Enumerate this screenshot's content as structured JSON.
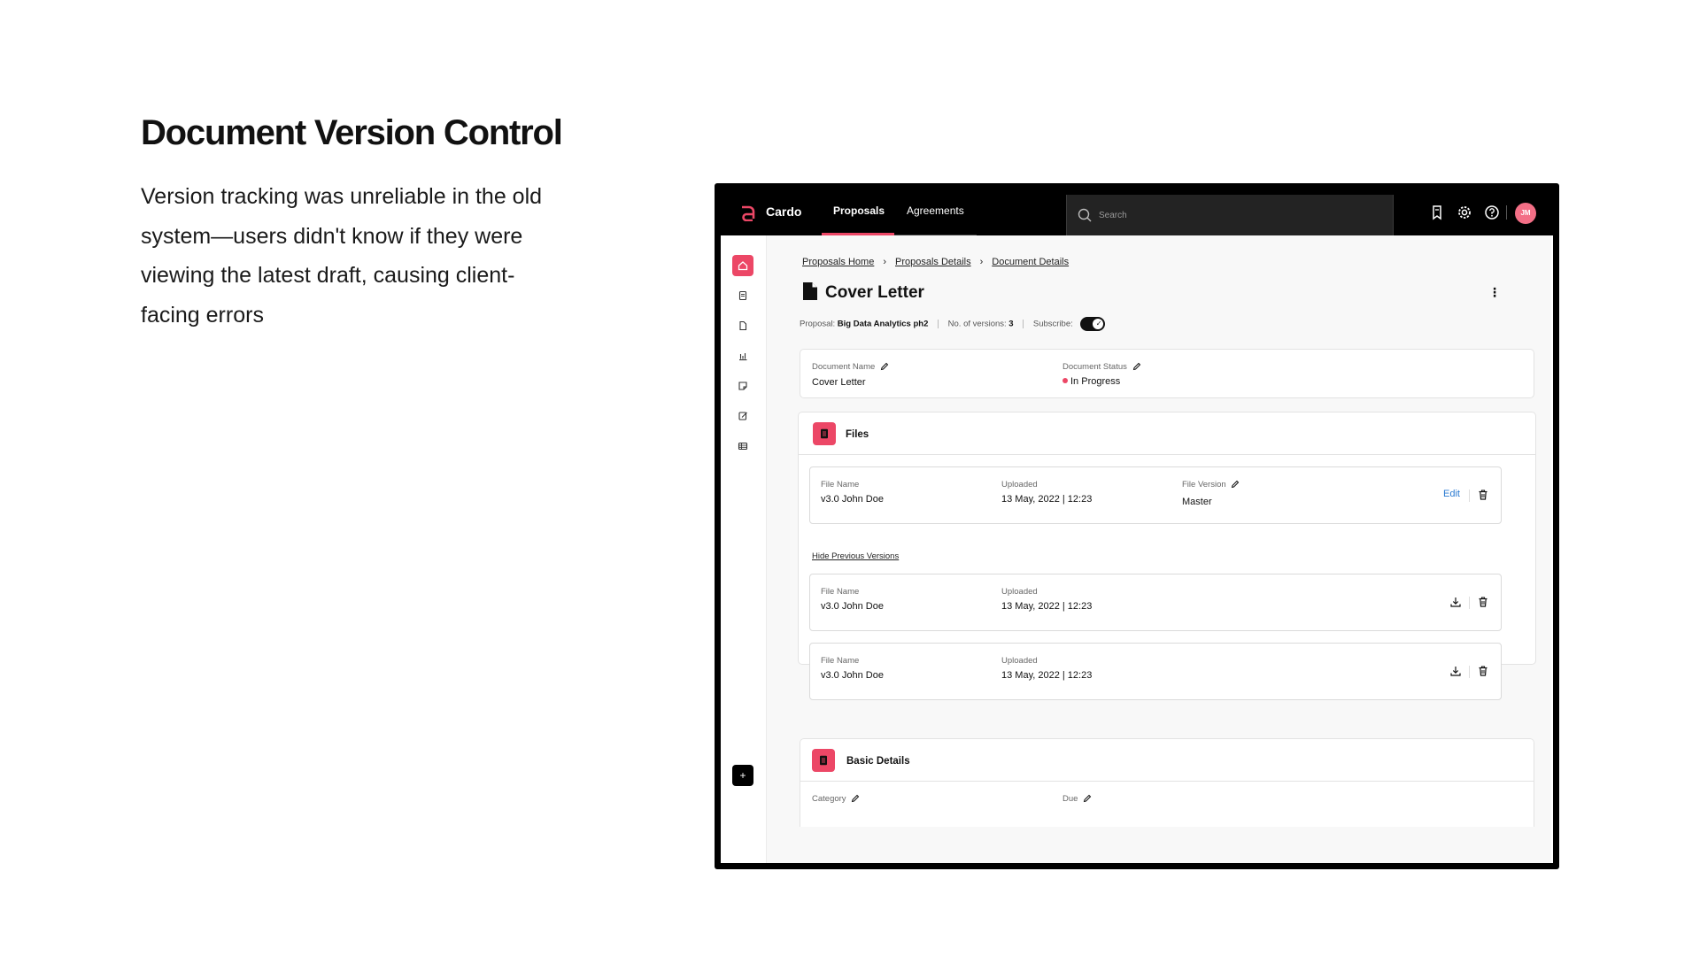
{
  "slide": {
    "title": "Document Version Control",
    "description": "Version tracking was unreliable in the old system—users didn't know if they were viewing the latest draft, causing client-facing errors"
  },
  "app": {
    "brand": "Cardo",
    "accent_color": "#ec4766",
    "nav": {
      "tabs": [
        {
          "label": "Proposals",
          "active": true
        },
        {
          "label": "Agreements",
          "active": false
        }
      ]
    },
    "search": {
      "placeholder": "Search",
      "icon": "search-icon"
    },
    "top_icons": [
      "bookmark-icon",
      "gear-icon",
      "help-icon"
    ],
    "avatar_initials": "JM",
    "sidebar": {
      "items": [
        "home-icon",
        "document-list-icon",
        "file-icon",
        "bar-chart-icon",
        "note-icon",
        "edit-note-icon",
        "table-icon"
      ],
      "add_label": "+"
    },
    "breadcrumb": [
      "Proposals Home",
      "Proposals Details",
      "Document Details"
    ],
    "page_title": "Cover Letter",
    "meta": {
      "proposal_label": "Proposal:",
      "proposal_value": "Big Data Analytics ph2",
      "versions_label": "No. of versions:",
      "versions_value": "3",
      "subscribe_label": "Subscribe:",
      "subscribed": true
    },
    "document_card": {
      "name_label": "Document Name",
      "name_value": "Cover Letter",
      "status_label": "Document Status",
      "status_value": "In Progress"
    },
    "files": {
      "title": "Files",
      "current": {
        "file_name_label": "File Name",
        "file_name": "v3.0 John Doe",
        "uploaded_label": "Uploaded",
        "uploaded": "13 May, 2022 | 12:23",
        "version_label": "File Version",
        "version": "Master",
        "edit_label": "Edit"
      },
      "hide_previous_label": "Hide Previous Versions",
      "previous": [
        {
          "file_name_label": "File Name",
          "file_name": "v3.0 John Doe",
          "uploaded_label": "Uploaded",
          "uploaded": "13 May, 2022 | 12:23"
        },
        {
          "file_name_label": "File Name",
          "file_name": "v3.0 John Doe",
          "uploaded_label": "Uploaded",
          "uploaded": "13 May, 2022 | 12:23"
        }
      ]
    },
    "basic_details": {
      "title": "Basic Details",
      "category_label": "Category",
      "due_label": "Due"
    }
  }
}
